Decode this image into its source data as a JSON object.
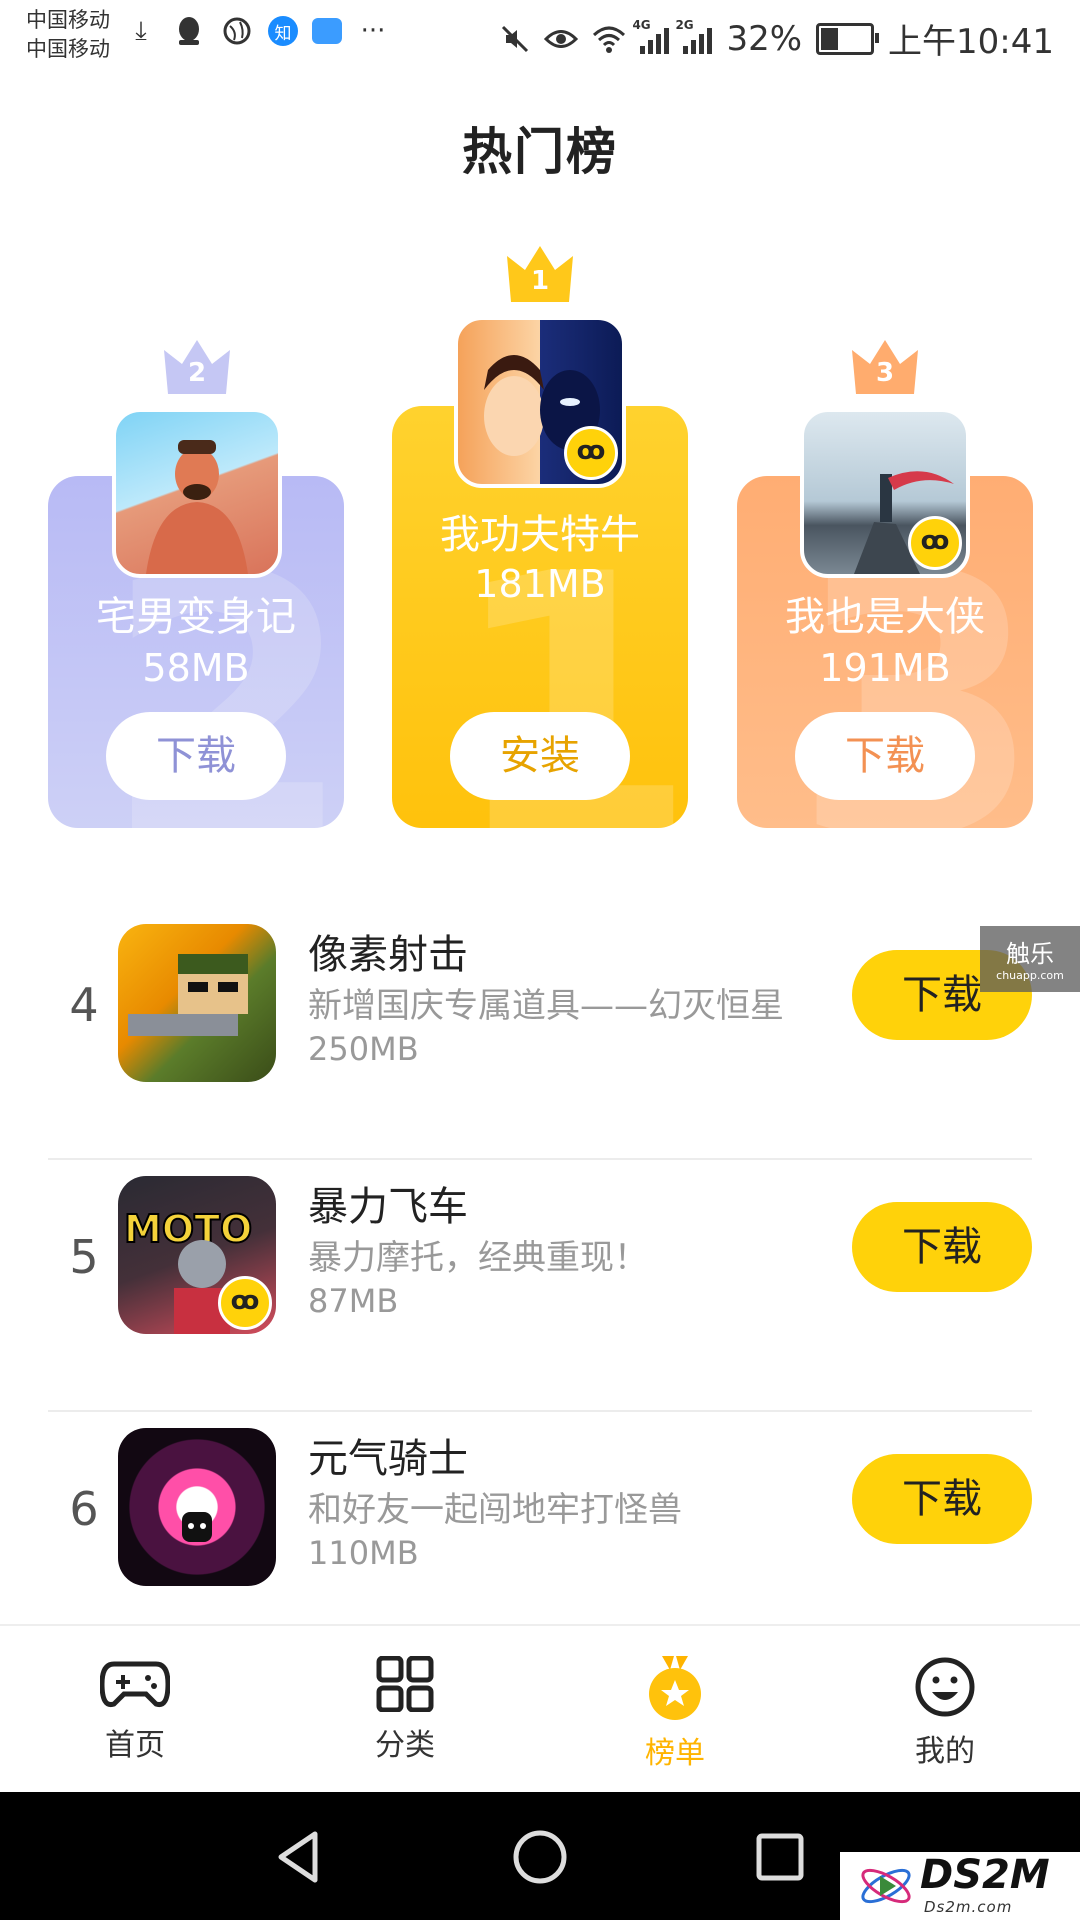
{
  "status_bar": {
    "carrier1": "中国移动",
    "carrier2": "中国移动",
    "zhihu_badge": "知",
    "more": "···",
    "net1": "4G",
    "net2": "2G",
    "battery": "32%",
    "time": "上午10:41"
  },
  "page": {
    "title": "热门榜"
  },
  "podium": [
    {
      "rank": "2",
      "name": "宅男变身记",
      "size": "58MB",
      "button": "下载",
      "icon": "muscle-man-icon"
    },
    {
      "rank": "1",
      "name": "我功夫特牛",
      "size": "181MB",
      "button": "安装",
      "icon": "kungfu-icon",
      "badge": "ꝏ"
    },
    {
      "rank": "3",
      "name": "我也是大侠",
      "size": "191MB",
      "button": "下载",
      "icon": "swordsman-icon",
      "badge": "ꝏ"
    }
  ],
  "list": [
    {
      "rank": "4",
      "title": "像素射击",
      "desc": "新增国庆专属道具——幻灭恒星",
      "size": "250MB",
      "button": "下载",
      "icon": "pixel-gun-icon"
    },
    {
      "rank": "5",
      "title": "暴力飞车",
      "desc": "暴力摩托，经典重现！",
      "size": "87MB",
      "button": "下载",
      "icon": "moto-icon",
      "badge": "ꝏ",
      "icon_text": "MOTO"
    },
    {
      "rank": "6",
      "title": "元气骑士",
      "desc": "和好友一起闯地牢打怪兽",
      "size": "110MB",
      "button": "下载",
      "icon": "soul-knight-icon"
    }
  ],
  "watermark_tag": {
    "line1": "触乐",
    "line2": "chuapp.com"
  },
  "tabs": [
    {
      "label": "首页",
      "icon": "gamepad-icon",
      "active": false
    },
    {
      "label": "分类",
      "icon": "grid-icon",
      "active": false
    },
    {
      "label": "榜单",
      "icon": "medal-icon",
      "active": true
    },
    {
      "label": "我的",
      "icon": "smiley-icon",
      "active": false
    }
  ],
  "colors": {
    "accent": "#ffd20a",
    "active_tab": "#ffb400",
    "rank2": "#b8baf5",
    "rank1": "#ffc20c",
    "rank3": "#ffad73"
  },
  "logo": {
    "name": "DS2M",
    "url": "Ds2m.com"
  }
}
